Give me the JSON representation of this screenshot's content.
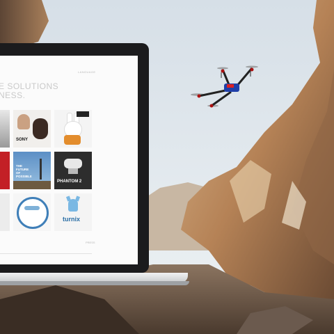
{
  "website": {
    "hero_text": "E SOLUTIONS\nNESS.",
    "nav_label": "LANGUAGE",
    "footer_label": "PRESS"
  },
  "tiles": [
    {
      "name": "sony-tile",
      "label": "SONY"
    },
    {
      "name": "miffy-tile",
      "label": ""
    },
    {
      "name": "future-tile",
      "label": "THE FUTURE OF POSSIBLE"
    },
    {
      "name": "phantom-tile",
      "label": "PHANTOM 2"
    },
    {
      "name": "circle-logo-tile",
      "label": ""
    },
    {
      "name": "turnix-tile",
      "label": "turnix"
    }
  ],
  "colors": {
    "sky": "#dfe6ec",
    "rock": "#c89a6a",
    "rock_shadow": "#7f5b3e",
    "laptop_bezel": "#1b1b1d",
    "screen_bg": "#fbfbfb",
    "accent_blue": "#3f7fb8",
    "accent_red": "#b41c22"
  }
}
